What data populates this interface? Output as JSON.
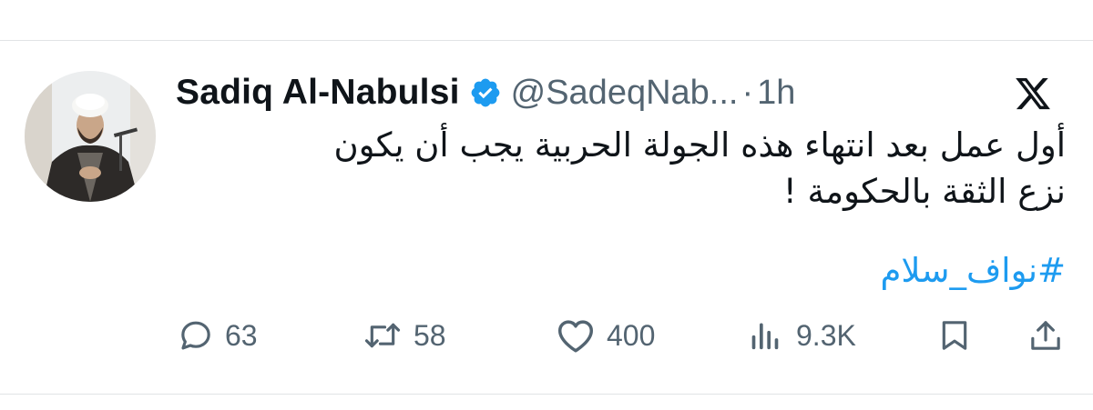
{
  "tweet": {
    "author_name": "Sadiq Al-Nabulsi",
    "handle": "@SadeqNab...",
    "separator": "·",
    "time": "1h",
    "text": "أول عمل بعد انتهاء هذه الجولة الحربية يجب أن يكون\nنزع الثقة بالحكومة !",
    "hashtag": "#نواف_سلام",
    "verified": true,
    "platform_icon": "x-logo-icon"
  },
  "actions": {
    "replies": "63",
    "reposts": "58",
    "likes": "400",
    "views": "9.3K",
    "icons": [
      "reply-icon",
      "repost-icon",
      "like-icon",
      "views-icon",
      "bookmark-icon",
      "share-icon"
    ]
  },
  "colors": {
    "text_primary": "#0f1419",
    "text_secondary": "#536471",
    "accent": "#1d9bf0",
    "divider": "#e1e3e6"
  }
}
